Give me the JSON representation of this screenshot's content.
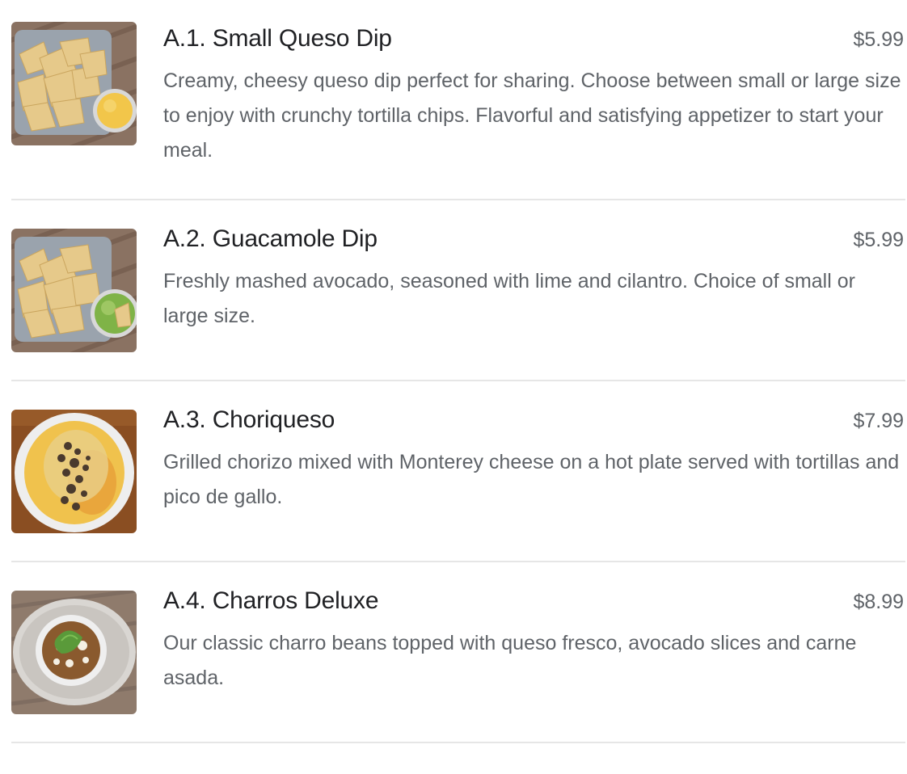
{
  "menu": {
    "items": [
      {
        "title": "A.1. Small Queso Dip",
        "price": "$5.99",
        "description": "Creamy, cheesy queso dip perfect for sharing. Choose between small or large size to enjoy with crunchy tortilla chips. Flavorful and satisfying appetizer to start your meal.",
        "image": "queso-dip-photo"
      },
      {
        "title": "A.2. Guacamole Dip",
        "price": "$5.99",
        "description": "Freshly mashed avocado, seasoned with lime and cilantro. Choice of small or large size.",
        "image": "guacamole-dip-photo"
      },
      {
        "title": "A.3. Choriqueso",
        "price": "$7.99",
        "description": "Grilled chorizo mixed with Monterey cheese on a hot plate served with tortillas and pico de gallo.",
        "image": "choriqueso-photo"
      },
      {
        "title": "A.4. Charros Deluxe",
        "price": "$8.99",
        "description": "Our classic charro beans topped with queso fresco, avocado slices and carne asada.",
        "image": "charros-deluxe-photo"
      }
    ]
  }
}
